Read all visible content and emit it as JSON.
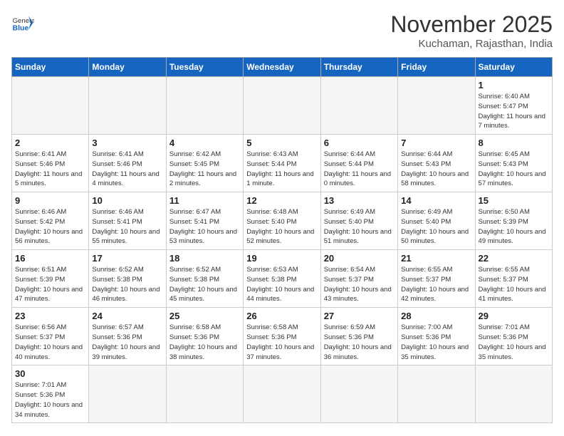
{
  "header": {
    "logo_general": "General",
    "logo_blue": "Blue",
    "month_title": "November 2025",
    "subtitle": "Kuchaman, Rajasthan, India"
  },
  "days_of_week": [
    "Sunday",
    "Monday",
    "Tuesday",
    "Wednesday",
    "Thursday",
    "Friday",
    "Saturday"
  ],
  "weeks": [
    [
      {
        "day": "",
        "empty": true
      },
      {
        "day": "",
        "empty": true
      },
      {
        "day": "",
        "empty": true
      },
      {
        "day": "",
        "empty": true
      },
      {
        "day": "",
        "empty": true
      },
      {
        "day": "",
        "empty": true
      },
      {
        "day": "1",
        "sunrise": "6:40 AM",
        "sunset": "5:47 PM",
        "daylight": "11 hours and 7 minutes."
      }
    ],
    [
      {
        "day": "2",
        "sunrise": "6:41 AM",
        "sunset": "5:46 PM",
        "daylight": "11 hours and 5 minutes."
      },
      {
        "day": "3",
        "sunrise": "6:41 AM",
        "sunset": "5:46 PM",
        "daylight": "11 hours and 4 minutes."
      },
      {
        "day": "4",
        "sunrise": "6:42 AM",
        "sunset": "5:45 PM",
        "daylight": "11 hours and 2 minutes."
      },
      {
        "day": "5",
        "sunrise": "6:43 AM",
        "sunset": "5:44 PM",
        "daylight": "11 hours and 1 minute."
      },
      {
        "day": "6",
        "sunrise": "6:44 AM",
        "sunset": "5:44 PM",
        "daylight": "11 hours and 0 minutes."
      },
      {
        "day": "7",
        "sunrise": "6:44 AM",
        "sunset": "5:43 PM",
        "daylight": "10 hours and 58 minutes."
      },
      {
        "day": "8",
        "sunrise": "6:45 AM",
        "sunset": "5:43 PM",
        "daylight": "10 hours and 57 minutes."
      }
    ],
    [
      {
        "day": "9",
        "sunrise": "6:46 AM",
        "sunset": "5:42 PM",
        "daylight": "10 hours and 56 minutes."
      },
      {
        "day": "10",
        "sunrise": "6:46 AM",
        "sunset": "5:41 PM",
        "daylight": "10 hours and 55 minutes."
      },
      {
        "day": "11",
        "sunrise": "6:47 AM",
        "sunset": "5:41 PM",
        "daylight": "10 hours and 53 minutes."
      },
      {
        "day": "12",
        "sunrise": "6:48 AM",
        "sunset": "5:40 PM",
        "daylight": "10 hours and 52 minutes."
      },
      {
        "day": "13",
        "sunrise": "6:49 AM",
        "sunset": "5:40 PM",
        "daylight": "10 hours and 51 minutes."
      },
      {
        "day": "14",
        "sunrise": "6:49 AM",
        "sunset": "5:40 PM",
        "daylight": "10 hours and 50 minutes."
      },
      {
        "day": "15",
        "sunrise": "6:50 AM",
        "sunset": "5:39 PM",
        "daylight": "10 hours and 49 minutes."
      }
    ],
    [
      {
        "day": "16",
        "sunrise": "6:51 AM",
        "sunset": "5:39 PM",
        "daylight": "10 hours and 47 minutes."
      },
      {
        "day": "17",
        "sunrise": "6:52 AM",
        "sunset": "5:38 PM",
        "daylight": "10 hours and 46 minutes."
      },
      {
        "day": "18",
        "sunrise": "6:52 AM",
        "sunset": "5:38 PM",
        "daylight": "10 hours and 45 minutes."
      },
      {
        "day": "19",
        "sunrise": "6:53 AM",
        "sunset": "5:38 PM",
        "daylight": "10 hours and 44 minutes."
      },
      {
        "day": "20",
        "sunrise": "6:54 AM",
        "sunset": "5:37 PM",
        "daylight": "10 hours and 43 minutes."
      },
      {
        "day": "21",
        "sunrise": "6:55 AM",
        "sunset": "5:37 PM",
        "daylight": "10 hours and 42 minutes."
      },
      {
        "day": "22",
        "sunrise": "6:55 AM",
        "sunset": "5:37 PM",
        "daylight": "10 hours and 41 minutes."
      }
    ],
    [
      {
        "day": "23",
        "sunrise": "6:56 AM",
        "sunset": "5:37 PM",
        "daylight": "10 hours and 40 minutes."
      },
      {
        "day": "24",
        "sunrise": "6:57 AM",
        "sunset": "5:36 PM",
        "daylight": "10 hours and 39 minutes."
      },
      {
        "day": "25",
        "sunrise": "6:58 AM",
        "sunset": "5:36 PM",
        "daylight": "10 hours and 38 minutes."
      },
      {
        "day": "26",
        "sunrise": "6:58 AM",
        "sunset": "5:36 PM",
        "daylight": "10 hours and 37 minutes."
      },
      {
        "day": "27",
        "sunrise": "6:59 AM",
        "sunset": "5:36 PM",
        "daylight": "10 hours and 36 minutes."
      },
      {
        "day": "28",
        "sunrise": "7:00 AM",
        "sunset": "5:36 PM",
        "daylight": "10 hours and 35 minutes."
      },
      {
        "day": "29",
        "sunrise": "7:01 AM",
        "sunset": "5:36 PM",
        "daylight": "10 hours and 35 minutes."
      }
    ],
    [
      {
        "day": "30",
        "sunrise": "7:01 AM",
        "sunset": "5:36 PM",
        "daylight": "10 hours and 34 minutes."
      },
      {
        "day": "",
        "empty": true
      },
      {
        "day": "",
        "empty": true
      },
      {
        "day": "",
        "empty": true
      },
      {
        "day": "",
        "empty": true
      },
      {
        "day": "",
        "empty": true
      },
      {
        "day": "",
        "empty": true
      }
    ]
  ]
}
